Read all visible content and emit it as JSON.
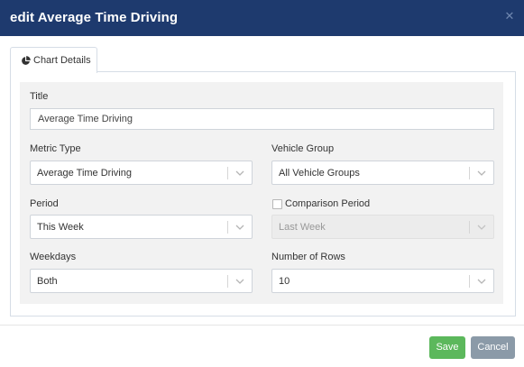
{
  "dialog": {
    "title": "edit Average Time Driving",
    "close_icon": "close-icon"
  },
  "tabs": [
    {
      "label": "Chart Details",
      "icon": "pie-chart-icon",
      "active": true
    }
  ],
  "form": {
    "title_label": "Title",
    "title_value": "Average Time Driving",
    "metric_type_label": "Metric Type",
    "metric_type_value": "Average Time Driving",
    "vehicle_group_label": "Vehicle Group",
    "vehicle_group_value": "All Vehicle Groups",
    "period_label": "Period",
    "period_value": "This Week",
    "comparison_label": "Comparison Period",
    "comparison_checked": false,
    "comparison_value": "Last Week",
    "weekdays_label": "Weekdays",
    "weekdays_value": "Both",
    "rows_label": "Number of Rows",
    "rows_value": "10"
  },
  "footer": {
    "save_label": "Save",
    "cancel_label": "Cancel"
  },
  "colors": {
    "header_bg": "#1e3a6e",
    "save_bg": "#5cb85c",
    "cancel_bg": "#8b9aa8"
  }
}
